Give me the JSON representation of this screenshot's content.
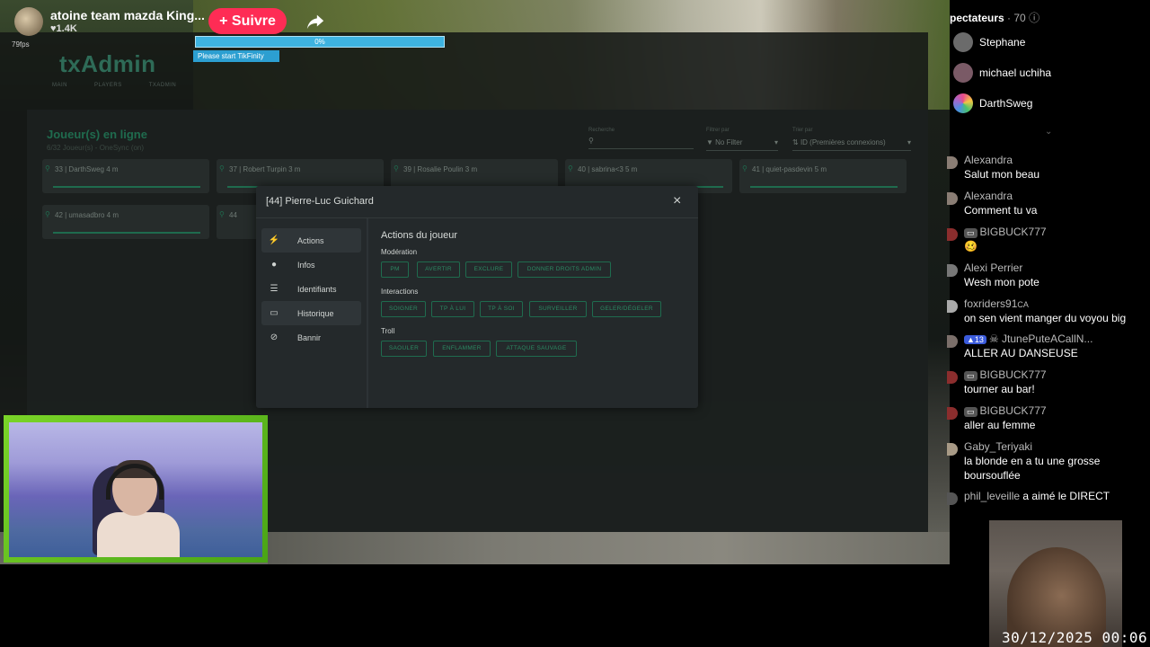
{
  "stream": {
    "title": "atoine team mazda King...",
    "likes": "♥1.4K",
    "follow_label": "+ Suivre",
    "fps": "79fps"
  },
  "tikfinity": {
    "progress_label": "0%",
    "progress": 0,
    "message": "Please start TikFinity"
  },
  "txadmin": {
    "logo": "txAdmin",
    "menu": [
      "MAIN",
      "PLAYERS",
      "TXADMIN"
    ],
    "players_title": "Joueur(s) en ligne",
    "players_sub": "6/32 Joueur(s) - OneSync (on)",
    "search_label": "Recherche",
    "filter_label": "Filtrer par",
    "filter_value": "No Filter",
    "sort_label": "Trier par",
    "sort_value": "ID (Premières connexions)",
    "players": [
      {
        "text": "33 | DarthSweg 4 m"
      },
      {
        "text": "37 | Robert Turpin 3 m"
      },
      {
        "text": "39 | Rosalie Poulin 3 m"
      },
      {
        "text": "40 | sabrina<3 5 m"
      },
      {
        "text": "41 | quiet-pasdevin 5 m"
      },
      {
        "text": "42 | umasadbro 4 m"
      },
      {
        "text": "44"
      }
    ]
  },
  "modal": {
    "title": "[44] Pierre-Luc Guichard",
    "close": "×",
    "side": [
      {
        "label": "Actions",
        "icon": "⚡"
      },
      {
        "label": "Infos",
        "icon": "●"
      },
      {
        "label": "Identifiants",
        "icon": "☰"
      },
      {
        "label": "Historique",
        "icon": "▭"
      },
      {
        "label": "Bannir",
        "icon": "⊘"
      }
    ],
    "actions_title": "Actions du joueur",
    "moderation_label": "Modération",
    "moderation": [
      "PM",
      "AVERTIR",
      "EXCLURE",
      "DONNER DROITS ADMIN"
    ],
    "interactions_label": "Interactions",
    "interactions": [
      "SOIGNER",
      "TP À LUI",
      "TP À SOI",
      "SURVEILLER",
      "GELER/DÉGELER"
    ],
    "troll_label": "Troll",
    "troll": [
      "SAOULER",
      "ENFLAMMER",
      "ATTAQUE SAUVAGE"
    ]
  },
  "spectators": {
    "label": "pectateurs",
    "count": "· 70",
    "viewers": [
      {
        "name": "Stephane",
        "color": "#6b6b6b"
      },
      {
        "name": "michael uchiha",
        "color": "#7a5a66"
      },
      {
        "name": "DarthSweg",
        "color": "#9c6bd1"
      }
    ]
  },
  "chat": [
    {
      "name": "Alexandra",
      "msg": "Salut mon beau",
      "color": "#8a7d74"
    },
    {
      "name": "Alexandra",
      "msg": "Comment tu va",
      "color": "#8a7d74"
    },
    {
      "name": "BIGBUCK777",
      "msg": "",
      "color": "#8b2d2d",
      "badge": "▭"
    },
    {
      "name": "Alexi Perrier",
      "msg": "Wesh mon pote",
      "color": "#777777"
    },
    {
      "name": "foxriders91",
      "msg": "on sen vient manger du voyou big",
      "color": "#aaaaaa"
    },
    {
      "name": "JtunePuteACallN...",
      "msg": "ALLER AU DANSEUSE",
      "color": "#7b6f6a",
      "badge": "13"
    },
    {
      "name": "BIGBUCK777",
      "msg": "tourner au bar!",
      "color": "#8b2d2d",
      "badge": "▭"
    },
    {
      "name": "BIGBUCK777",
      "msg": "aller au femme",
      "color": "#8b2d2d",
      "badge": "▭"
    },
    {
      "name": "Gaby_Teriyaki",
      "msg": "la blonde en a tu une grosse",
      "msg2": "boursouflée",
      "color": "#a89a86"
    },
    {
      "name": "phil_leveille",
      "msg": "",
      "suffix": "a aimé le DIRECT",
      "color": "#555555"
    }
  ],
  "datetime": "30/12/2025 00:06"
}
